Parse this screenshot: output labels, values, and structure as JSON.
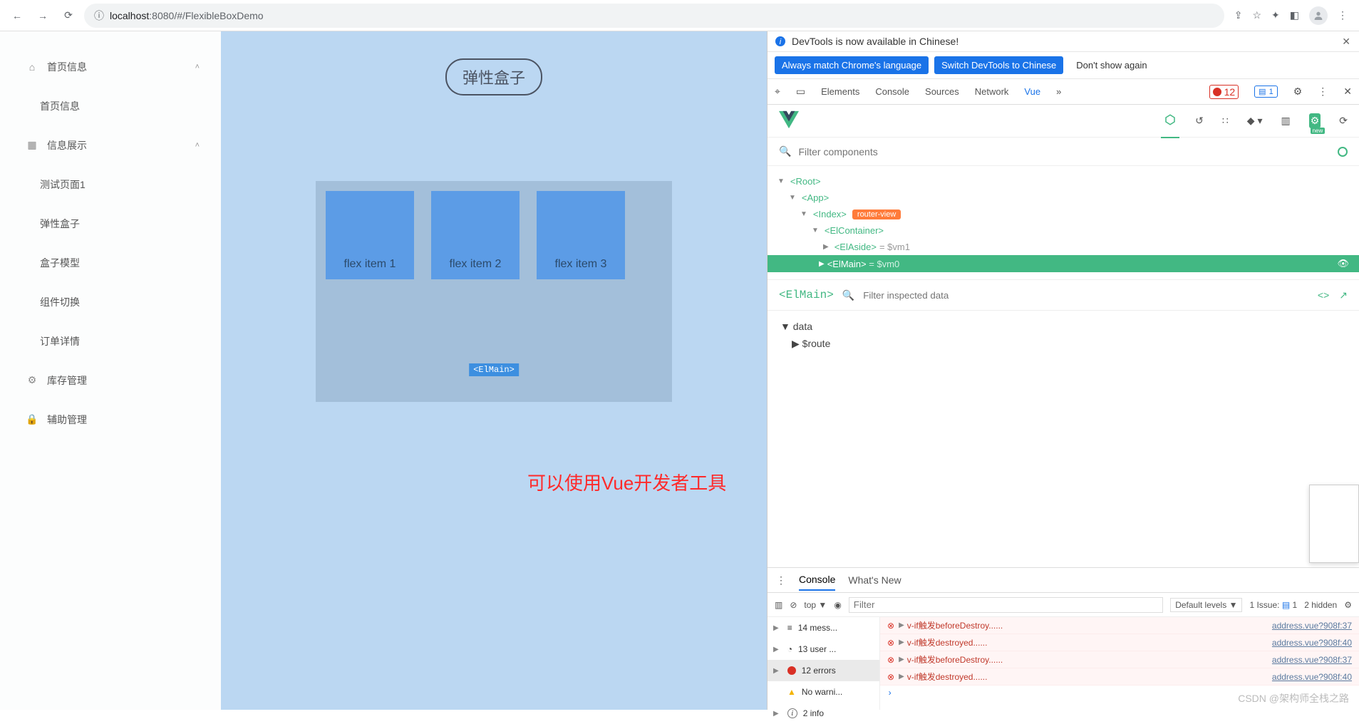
{
  "browser": {
    "url_prefix": "localhost",
    "url_port": ":8080",
    "url_path": "/#/FlexibleBoxDemo"
  },
  "sidebar": {
    "items": [
      {
        "label": "首页信息",
        "icon": "home",
        "expandable": true
      },
      {
        "label": "首页信息",
        "sub": true
      },
      {
        "label": "信息展示",
        "icon": "grid",
        "expandable": true
      },
      {
        "label": "测试页面1",
        "sub": true
      },
      {
        "label": "弹性盒子",
        "sub": true
      },
      {
        "label": "盒子模型",
        "sub": true
      },
      {
        "label": "组件切换",
        "sub": true
      },
      {
        "label": "订单详情",
        "sub": true
      },
      {
        "label": "库存管理",
        "icon": "gear"
      },
      {
        "label": "辅助管理",
        "icon": "lock"
      }
    ]
  },
  "content": {
    "title": "弹性盒子",
    "items": [
      "flex item 1",
      "flex item 2",
      "flex item 3"
    ],
    "badge": "<ElMain>",
    "note": "可以使用Vue开发者工具"
  },
  "devtools": {
    "info": "DevTools is now available in Chinese!",
    "btn1": "Always match Chrome's language",
    "btn2": "Switch DevTools to Chinese",
    "btn3": "Don't show again",
    "tabs": [
      "Elements",
      "Console",
      "Sources",
      "Network",
      "Vue"
    ],
    "errors": "12",
    "issues": "1",
    "filter_ph": "Filter components",
    "tree": {
      "root": "<Root>",
      "app": "<App>",
      "index": "<Index>",
      "rv": "router-view",
      "container": "<ElContainer>",
      "aside": "<ElAside>",
      "aside_vm": "= $vm1",
      "main": "<ElMain>",
      "main_vm": "= $vm0"
    },
    "inspect": {
      "name": "<ElMain>",
      "ph": "Filter inspected data",
      "data": "data",
      "route": "$route"
    },
    "console": {
      "tab1": "Console",
      "tab2": "What's New",
      "top": "top",
      "filter_ph": "Filter",
      "levels": "Default levels",
      "issue_lbl": "1 Issue:",
      "issue_n": "1",
      "hidden": "2 hidden",
      "side": [
        {
          "label": "14 mess...",
          "icon": "list"
        },
        {
          "label": "13 user ...",
          "icon": "user"
        },
        {
          "label": "12 errors",
          "icon": "err",
          "sel": true
        },
        {
          "label": "No warni...",
          "icon": "warn"
        },
        {
          "label": "2 info",
          "icon": "info"
        }
      ],
      "msgs": [
        {
          "t": "v-if触发beforeDestroy......",
          "s": "address.vue?908f:37"
        },
        {
          "t": "v-if触发destroyed......",
          "s": "address.vue?908f:40"
        },
        {
          "t": "v-if触发beforeDestroy......",
          "s": "address.vue?908f:37"
        },
        {
          "t": "v-if触发destroyed......",
          "s": "address.vue?908f:40"
        }
      ]
    },
    "watermark": "CSDN @架构师全栈之路"
  }
}
